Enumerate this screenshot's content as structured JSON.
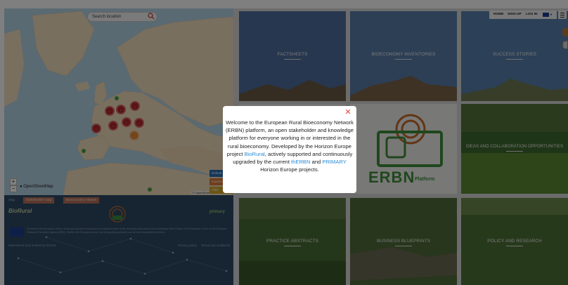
{
  "map": {
    "search_placeholder": "Search location",
    "zoom_in": "+",
    "zoom_out": "−",
    "osm_label": "OpenStreetMap",
    "osm_credit": "© OpenStreetMap contributors",
    "side_buttons": [
      {
        "label": "Default",
        "color": "#2b6fb4"
      },
      {
        "label": "Explore",
        "color": "#e07b39"
      },
      {
        "label": "Filter",
        "color": "#d9a92b"
      }
    ],
    "colors": {
      "cluster_red": "#b3262a",
      "cluster_orange": "#e8862c",
      "cluster_green": "#4aa23f",
      "land": "#f2dfbf",
      "water": "#b4d4e6"
    }
  },
  "footer": {
    "tabs": [
      "Map",
      "Stakeholder map",
      "Bioeconomy Atlases"
    ],
    "logo_left": "BioRural",
    "logo_right": "primary",
    "funding_text": "Funded by the European Union. Views and opinions expressed are however those of the author(s) only and do not necessarily reflect those of the European Union or the European Research Executive Agency (REA). Neither the European Union nor the granting authority can be held responsible for them.",
    "designed_text": "Maintained and hosted by",
    "designed_link": "ECHN",
    "privacy": "Privacy policy",
    "terms": "Terms and conditions"
  },
  "nav": {
    "home": "HOME",
    "signup": "SIGN UP",
    "login": "LOG IN",
    "caret": "▾"
  },
  "tiles": [
    {
      "label": "FACTSHEETS"
    },
    {
      "label": "BIOECONOMY INVENTORIES"
    },
    {
      "label": "SUCCESS STORIES"
    },
    {
      "label": "IDEAS AND COLLABORATION OPPORTUNITIES"
    },
    {
      "label": "PRACTICE ABSTRACTS"
    },
    {
      "label": "BUSINESS BLUEPRINTS"
    },
    {
      "label": "POLICY AND RESEARCH"
    }
  ],
  "center_logo": {
    "word": "ERBN",
    "sub": "Platform",
    "color": "#3f8f3a"
  },
  "modal": {
    "close": "✕",
    "text_1": "Welcome to the European Rural Bioeconomy Network (ERBN) platform, an open stakeholder and knowledge platform for everyone working in or interested in the rural bioeconomy. Developed by the Horizon Europe project ",
    "link_1": "BioRural",
    "text_2": ", actively supported and continuously upgraded by the current ",
    "link_2": "thERBN",
    "text_3": " and ",
    "link_3": "PRIMARY",
    "text_4": " Horizon Europe projects."
  }
}
